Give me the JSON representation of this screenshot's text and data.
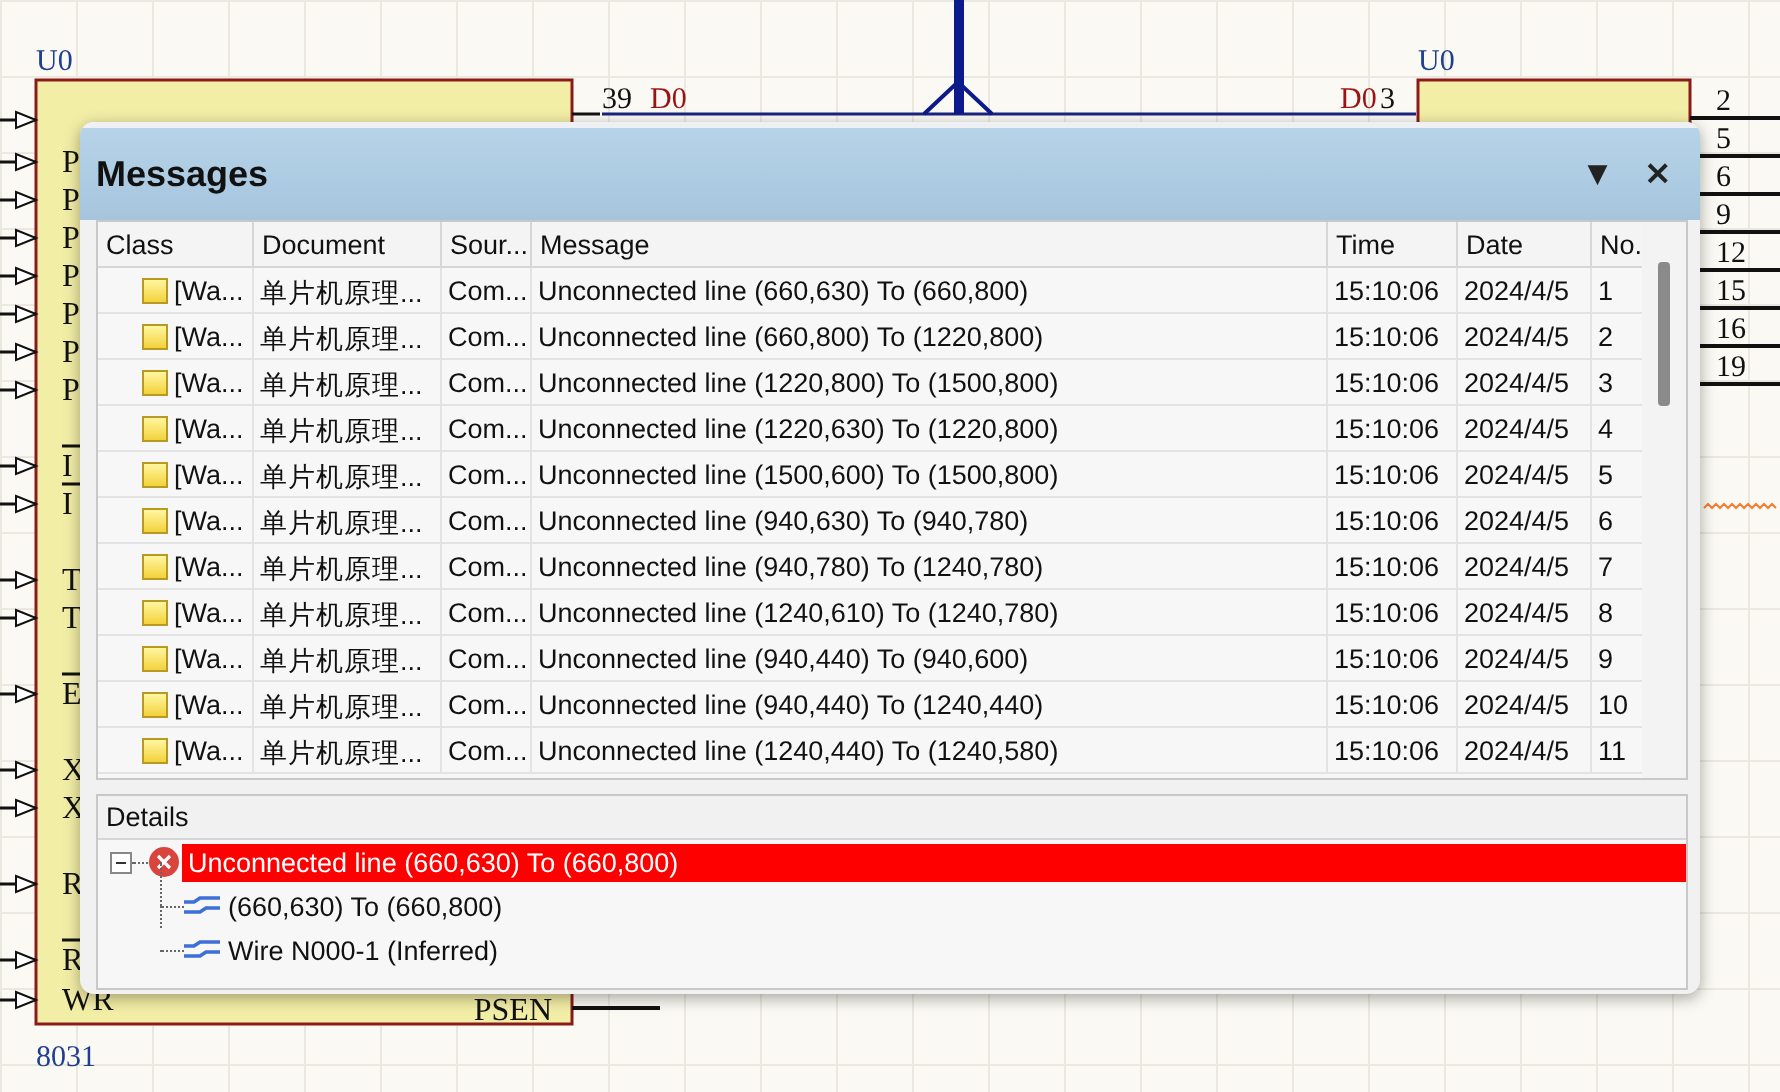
{
  "schematic": {
    "left_part": {
      "designator": "U0",
      "type": "8031",
      "left_pins": [
        {
          "name": "P",
          "overbar": false
        },
        {
          "name": "P",
          "overbar": false
        },
        {
          "name": "P",
          "overbar": false
        },
        {
          "name": "P",
          "overbar": false
        },
        {
          "name": "P",
          "overbar": false
        },
        {
          "name": "P",
          "overbar": false
        },
        {
          "name": "P",
          "overbar": false
        },
        {
          "name": "I",
          "overbar": true
        },
        {
          "name": "I",
          "overbar": true
        },
        {
          "name": "T",
          "overbar": false
        },
        {
          "name": "T",
          "overbar": false
        },
        {
          "name": "E",
          "overbar": true
        },
        {
          "name": "X",
          "overbar": false
        },
        {
          "name": "X",
          "overbar": false
        },
        {
          "name": "R",
          "overbar": false
        },
        {
          "name": "R",
          "overbar": true
        },
        {
          "name": "WR",
          "overbar": false
        }
      ],
      "right_pins": [
        {
          "number": "39"
        },
        {
          "name": "PSEN"
        }
      ]
    },
    "net_labels": [
      "D0",
      "D0"
    ],
    "right_part": {
      "designator": "U0",
      "input_pin_number": "3",
      "outputs": [
        {
          "number": "2"
        },
        {
          "number": "5"
        },
        {
          "number": "6"
        },
        {
          "number": "9"
        },
        {
          "number": "12"
        },
        {
          "number": "15"
        },
        {
          "number": "16"
        },
        {
          "number": "19"
        }
      ]
    }
  },
  "messages": {
    "title": "Messages",
    "menu_glyph": "▼",
    "close_glyph": "×",
    "columns": [
      "Class",
      "Document",
      "Sour...",
      "Message",
      "Time",
      "Date",
      "No."
    ],
    "rows": [
      {
        "class": "[Wa...",
        "document": "单片机原理...",
        "source": "Com...",
        "message": "Unconnected line (660,630) To (660,800)",
        "time": "15:10:06",
        "date": "2024/4/5",
        "no": "1"
      },
      {
        "class": "[Wa...",
        "document": "单片机原理...",
        "source": "Com...",
        "message": "Unconnected line (660,800) To (1220,800)",
        "time": "15:10:06",
        "date": "2024/4/5",
        "no": "2"
      },
      {
        "class": "[Wa...",
        "document": "单片机原理...",
        "source": "Com...",
        "message": "Unconnected line (1220,800) To (1500,800)",
        "time": "15:10:06",
        "date": "2024/4/5",
        "no": "3"
      },
      {
        "class": "[Wa...",
        "document": "单片机原理...",
        "source": "Com...",
        "message": "Unconnected line (1220,630) To (1220,800)",
        "time": "15:10:06",
        "date": "2024/4/5",
        "no": "4"
      },
      {
        "class": "[Wa...",
        "document": "单片机原理...",
        "source": "Com...",
        "message": "Unconnected line (1500,600) To (1500,800)",
        "time": "15:10:06",
        "date": "2024/4/5",
        "no": "5"
      },
      {
        "class": "[Wa...",
        "document": "单片机原理...",
        "source": "Com...",
        "message": "Unconnected line (940,630) To (940,780)",
        "time": "15:10:06",
        "date": "2024/4/5",
        "no": "6"
      },
      {
        "class": "[Wa...",
        "document": "单片机原理...",
        "source": "Com...",
        "message": "Unconnected line (940,780) To (1240,780)",
        "time": "15:10:06",
        "date": "2024/4/5",
        "no": "7"
      },
      {
        "class": "[Wa...",
        "document": "单片机原理...",
        "source": "Com...",
        "message": "Unconnected line (1240,610) To (1240,780)",
        "time": "15:10:06",
        "date": "2024/4/5",
        "no": "8"
      },
      {
        "class": "[Wa...",
        "document": "单片机原理...",
        "source": "Com...",
        "message": "Unconnected line (940,440) To (940,600)",
        "time": "15:10:06",
        "date": "2024/4/5",
        "no": "9"
      },
      {
        "class": "[Wa...",
        "document": "单片机原理...",
        "source": "Com...",
        "message": "Unconnected line (940,440) To (1240,440)",
        "time": "15:10:06",
        "date": "2024/4/5",
        "no": "10"
      },
      {
        "class": "[Wa...",
        "document": "单片机原理...",
        "source": "Com...",
        "message": "Unconnected line (1240,440) To (1240,580)",
        "time": "15:10:06",
        "date": "2024/4/5",
        "no": "11"
      }
    ],
    "details": {
      "title": "Details",
      "tree": [
        {
          "kind": "error",
          "text": "Unconnected line (660,630) To (660,800)",
          "selected": true,
          "expanded": true,
          "children": [
            {
              "kind": "wire",
              "text": "(660,630) To (660,800)",
              "selected": false
            },
            {
              "kind": "wire",
              "text": "Wire N000-1 (Inferred)",
              "selected": false
            }
          ]
        }
      ]
    }
  }
}
